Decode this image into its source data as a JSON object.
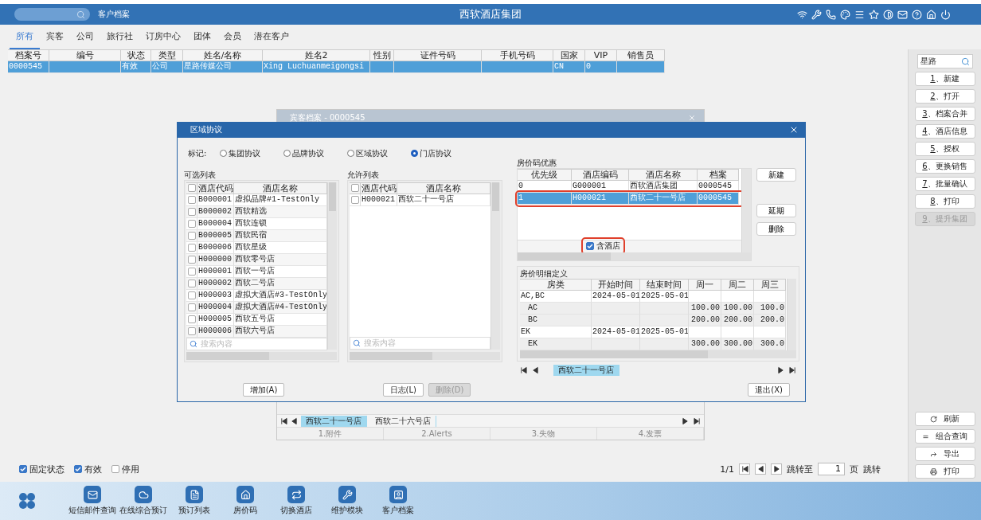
{
  "window": {
    "module": "客户档案",
    "title": "西软酒店集团"
  },
  "tabs": [
    {
      "label": "所有",
      "selected": true
    },
    {
      "label": "宾客",
      "selected": false
    },
    {
      "label": "公司",
      "selected": false
    },
    {
      "label": "旅行社",
      "selected": false
    },
    {
      "label": "订房中心",
      "selected": false
    },
    {
      "label": "团体",
      "selected": false
    },
    {
      "label": "会员",
      "selected": false
    },
    {
      "label": "潜在客户",
      "selected": false
    }
  ],
  "table": {
    "columns": [
      "档案号",
      "编号",
      "状态",
      "类型",
      "姓名/名称",
      "姓名2",
      "性别",
      "证件号码",
      "手机号码",
      "国家",
      "VIP",
      "销售员"
    ],
    "rows": [
      {
        "cells": [
          "0000545",
          null,
          "有效",
          "公司",
          "星路传媒公司",
          "Xing Luchuanmeigongsi",
          null,
          null,
          null,
          "CN",
          "0",
          null
        ],
        "selected": true
      }
    ]
  },
  "sidebar": {
    "search": {
      "value": "星路"
    },
    "actions": [
      {
        "key": "1",
        "label": "、新建",
        "disabled": false
      },
      {
        "key": "2",
        "label": "、打开",
        "disabled": false
      },
      {
        "key": "3",
        "label": "、档案合并",
        "disabled": false
      },
      {
        "key": "4",
        "label": "、酒店信息",
        "disabled": false
      },
      {
        "key": "5",
        "label": "、授权",
        "disabled": false
      },
      {
        "key": "6",
        "label": "、更换销售",
        "disabled": false
      },
      {
        "key": "7",
        "label": "、批量确认",
        "disabled": false
      },
      {
        "key": "8",
        "label": "、打印",
        "disabled": false
      },
      {
        "key": "9",
        "label": "、提升集团",
        "disabled": true
      }
    ],
    "tools": [
      {
        "label": "刷新"
      },
      {
        "label": "组合查询"
      },
      {
        "label": "导出"
      },
      {
        "label": "打印"
      }
    ]
  },
  "filters": [
    {
      "label": "固定状态",
      "checked": true
    },
    {
      "label": "有效",
      "checked": true
    },
    {
      "label": "停用",
      "checked": false
    }
  ],
  "pager": {
    "page": "1/1",
    "goto_label": "跳转至",
    "goto_value": "1",
    "unit": "页",
    "go": "跳转"
  },
  "taskbar": [
    {
      "label": "短信邮件查询"
    },
    {
      "label": "在线综合预订"
    },
    {
      "label": "预订列表"
    },
    {
      "label": "房价码"
    },
    {
      "label": "切换酒店"
    },
    {
      "label": "维护模块"
    },
    {
      "label": "客户档案"
    }
  ],
  "background_window": {
    "title": "宾客档案 - 0000545",
    "tabs": [
      {
        "label": "西软二十一号店",
        "selected": true
      },
      {
        "label": "西软二十六号店",
        "selected": false
      }
    ],
    "sections": [
      "1.附件",
      "2.Alerts",
      "3.失物",
      "4.发票"
    ]
  },
  "dialog": {
    "title": "区域协议",
    "mark_label": "标记:",
    "marks": [
      {
        "label": "集团协议",
        "selected": false
      },
      {
        "label": "品牌协议",
        "selected": false
      },
      {
        "label": "区域协议",
        "selected": false
      },
      {
        "label": "门店协议",
        "selected": true
      }
    ],
    "available": {
      "title": "可选列表",
      "all_checked": false,
      "columns": [
        "酒店代码",
        "酒店名称"
      ],
      "search": {
        "placeholder": "搜索内容"
      },
      "rows": [
        {
          "code": "B000001",
          "name": "虚拟品牌#1-TestOnly",
          "checked": false
        },
        {
          "code": "B000002",
          "name": "西软精选",
          "checked": false
        },
        {
          "code": "B000004",
          "name": "西软连锁",
          "checked": false
        },
        {
          "code": "B000005",
          "name": "西软民宿",
          "checked": false
        },
        {
          "code": "B000006",
          "name": "西软星级",
          "checked": false
        },
        {
          "code": "H000000",
          "name": "西软零号店",
          "checked": false
        },
        {
          "code": "H000001",
          "name": "西软一号店",
          "checked": false
        },
        {
          "code": "H000002",
          "name": "西软二号店",
          "checked": false
        },
        {
          "code": "H000003",
          "name": "虚拟大酒店#3-TestOnly",
          "checked": false
        },
        {
          "code": "H000004",
          "name": "虚拟大酒店#4-TestOnly",
          "checked": false
        },
        {
          "code": "H000005",
          "name": "西软五号店",
          "checked": false
        },
        {
          "code": "H000006",
          "name": "西软六号店",
          "checked": false
        }
      ]
    },
    "allowed": {
      "title": "允许列表",
      "all_checked": false,
      "columns": [
        "酒店代码",
        "酒店名称"
      ],
      "search": {
        "placeholder": "搜索内容"
      },
      "rows": [
        {
          "code": "H000021",
          "name": "西软二十一号店",
          "checked": false
        }
      ]
    },
    "rate_codes": {
      "title": "房价码优惠",
      "columns": [
        "优先级",
        "酒店编码",
        "酒店名称",
        "档案"
      ],
      "rows": [
        {
          "cells": [
            "0",
            "G000001",
            "西软酒店集团",
            "0000545"
          ],
          "selected": false,
          "highlighted": false
        },
        {
          "cells": [
            "1",
            "H000021",
            "西软二十一号店",
            "0000545"
          ],
          "selected": true,
          "highlighted": true
        }
      ],
      "include_hotel": {
        "label": "含酒店",
        "checked": true,
        "highlighted": true
      },
      "buttons": [
        {
          "label": "新建"
        },
        {
          "label": "延期"
        },
        {
          "label": "删除"
        }
      ]
    },
    "rate_details": {
      "title": "房价明细定义",
      "columns": [
        "房类",
        "开始时间",
        "结束时间",
        "周一",
        "周二",
        "周三"
      ],
      "rows": [
        {
          "cells": [
            "AC,BC",
            "2024-05-01",
            "2025-05-01",
            null,
            null,
            null
          ],
          "children": [
            {
              "cells": [
                "AC",
                null,
                null,
                "100.00",
                "100.00",
                "100.0"
              ]
            },
            {
              "cells": [
                "BC",
                null,
                null,
                "200.00",
                "200.00",
                "200.0"
              ]
            }
          ]
        },
        {
          "cells": [
            "EK",
            "2024-05-01",
            "2025-05-01",
            null,
            null,
            null
          ],
          "children": [
            {
              "cells": [
                "EK",
                null,
                null,
                "300.00",
                "300.00",
                "300.0"
              ]
            }
          ]
        }
      ]
    },
    "hotel_tabs": [
      {
        "label": "西软二十一号店",
        "selected": true
      }
    ],
    "buttons": [
      {
        "label": "增加(A)",
        "disabled": false
      },
      {
        "label": "日志(L)",
        "disabled": false
      },
      {
        "label": "删除(D)",
        "disabled": true
      },
      {
        "label": "退出(X)",
        "disabled": false
      }
    ]
  }
}
